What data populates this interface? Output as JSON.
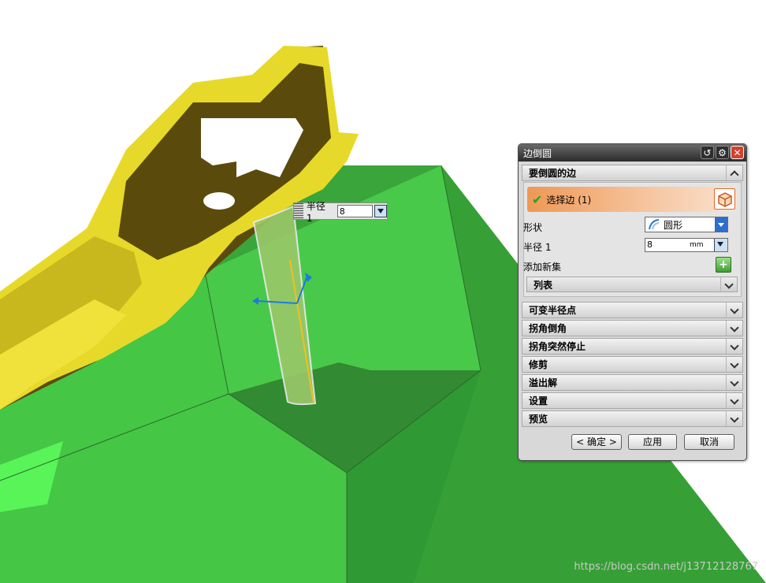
{
  "floating_input": {
    "label": "半径 1",
    "value": "8"
  },
  "dialog": {
    "title": "边倒圆",
    "title_buttons": [
      "reset-icon",
      "settings-icon",
      "close-icon"
    ],
    "section_edges": {
      "title": "要倒圆的边",
      "select_edge_label": "选择边 (1)",
      "shape_label": "形状",
      "shape_value": "圆形",
      "radius_label": "半径 1",
      "radius_value": "8",
      "radius_unit": "mm",
      "add_set_label": "添加新集",
      "list_label": "列表"
    },
    "collapsed_sections": [
      "可变半径点",
      "拐角倒角",
      "拐角突然停止",
      "修剪",
      "溢出解",
      "设置",
      "预览"
    ],
    "buttons": {
      "ok": "< 确定 >",
      "apply": "应用",
      "cancel": "取消"
    }
  },
  "watermark": "https://blog.csdn.net/j13712128767",
  "colors": {
    "green_body": "#40b340",
    "yellow_part": "#ddd020",
    "accent_orange": "#ee9855",
    "close_red": "#d6402c"
  }
}
